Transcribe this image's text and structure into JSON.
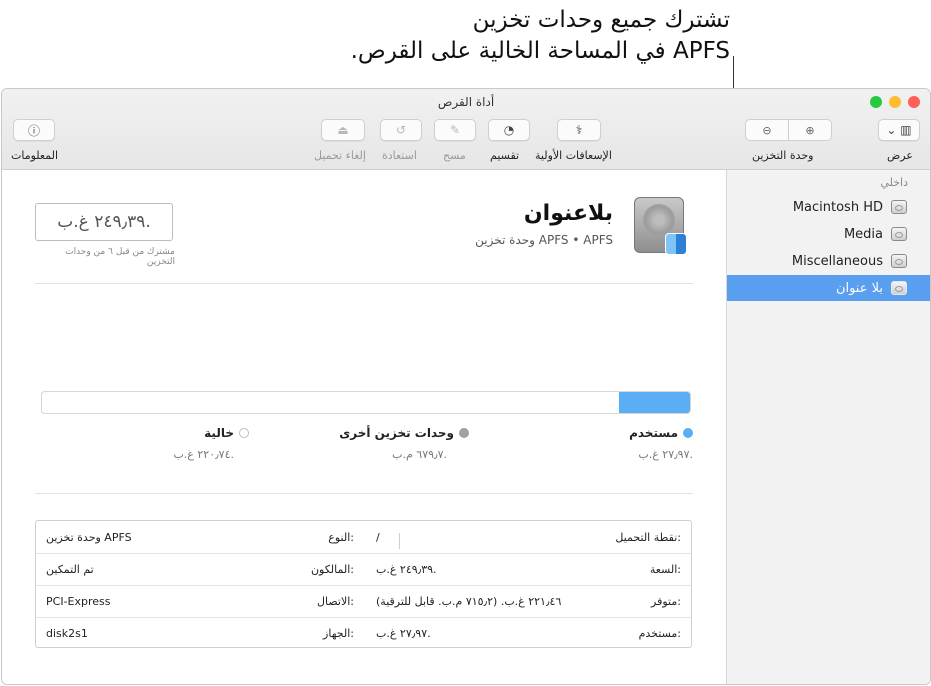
{
  "callout": {
    "line1": "تشترك جميع وحدات تخزين",
    "line2": "APFS في المساحة الخالية على القرص."
  },
  "window": {
    "title": "أداة القرص",
    "traffic_colors": {
      "close": "#fe5f57",
      "minimize": "#febc2e",
      "zoom": "#28c840"
    }
  },
  "toolbar": {
    "info_label": "المعلومات",
    "unmount_label": "إلغاء تحميل",
    "restore_label": "استعادة",
    "erase_label": "مسح",
    "partition_label": "تقسيم",
    "firstaid_label": "الإسعافات الأولية",
    "volume_label": "وحدة التخزين",
    "view_label": "عرض"
  },
  "sidebar": {
    "header": "داخلي",
    "items": [
      {
        "label": "Macintosh HD",
        "selected": false
      },
      {
        "label": "Media",
        "selected": false
      },
      {
        "label": "Miscellaneous",
        "selected": false
      },
      {
        "label": "بلا عنوان",
        "selected": true
      }
    ]
  },
  "volume": {
    "name": "بلاعنوان",
    "subtitle": "وحدة تخزين APFS • APFS",
    "size": "٢٤٩٫٣٩ غ.ب.",
    "shared_note": "مشترك من قبل ٦ من وحدات التخزين"
  },
  "usage": {
    "used_fraction": 0.11,
    "accent": "#5aaef4",
    "used": {
      "label": "مستخدم",
      "value": "٢٧٫٩٧ غ.ب."
    },
    "other": {
      "label": "وحدات تخزين أخرى",
      "value": "٦٧٩٫٧ م.ب."
    },
    "free": {
      "label": "خالية",
      "value": "٢٢٠٫٧٤ غ.ب."
    }
  },
  "info": {
    "mount_point": {
      "key": "نقطة التحميل:",
      "value": "/"
    },
    "capacity": {
      "key": "السعة:",
      "value": "٢٤٩٫٣٩ غ.ب."
    },
    "available": {
      "key": "متوفر:",
      "value": "٢٢١٫٤٦ غ.ب. (٧١٥٫٢ م.ب. قابل للترقية)"
    },
    "used": {
      "key": "مستخدم:",
      "value": "٢٧٫٩٧ غ.ب."
    },
    "type": {
      "key": "النوع:",
      "value": "وحدة تخزين APFS"
    },
    "owners": {
      "key": "المالكون:",
      "value": "تم التمكين"
    },
    "connection": {
      "key": "الاتصال:",
      "value": "PCI-Express"
    },
    "device": {
      "key": "الجهاز:",
      "value": "disk2s1"
    }
  }
}
